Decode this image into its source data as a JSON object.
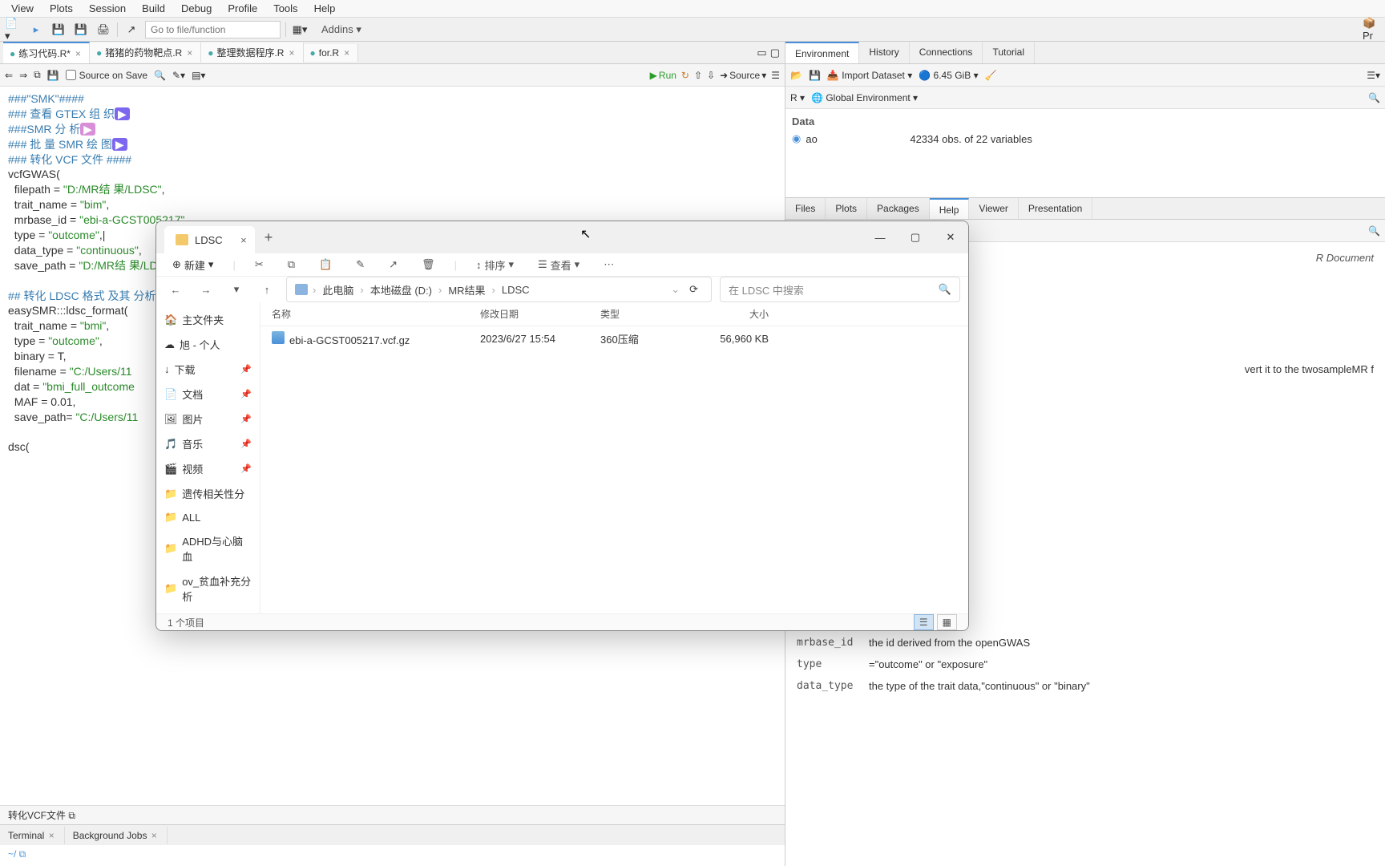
{
  "rstudio": {
    "menu": [
      "View",
      "Plots",
      "Session",
      "Build",
      "Debug",
      "Profile",
      "Tools",
      "Help"
    ],
    "goto_placeholder": "Go to file/function",
    "addins": "Addins",
    "source_tabs": [
      {
        "label": "练习代码.R*",
        "active": true
      },
      {
        "label": "猪猪的药物靶点.R"
      },
      {
        "label": "整理数据程序.R"
      },
      {
        "label": "for.R"
      }
    ],
    "source_on_save": "Source on Save",
    "run": "Run",
    "source_btn": "Source",
    "code_lines": [
      {
        "t": "comment",
        "v": "###\"SMK\"####"
      },
      {
        "t": "comment_btn",
        "v": "### 查看 GTEX 组 织",
        "btn": "▶"
      },
      {
        "t": "comment_btn2",
        "v": "###SMR 分 析",
        "btn": "▶"
      },
      {
        "t": "comment_btn",
        "v": "### 批 量 SMR 绘 图",
        "btn": "▶"
      },
      {
        "t": "comment",
        "v": "### 转化 VCF 文件 ####"
      },
      {
        "t": "plain",
        "v": "vcfGWAS("
      },
      {
        "t": "arg",
        "k": "  filepath = ",
        "s": "\"D:/MR结 果/LDSC\"",
        "e": ","
      },
      {
        "t": "arg",
        "k": "  trait_name = ",
        "s": "\"bim\"",
        "e": ","
      },
      {
        "t": "arg",
        "k": "  mrbase_id = ",
        "s": "\"ebi-a-GCST005217\"",
        "e": ","
      },
      {
        "t": "arg",
        "k": "  type = ",
        "s": "\"outcome\"",
        "e": ",|"
      },
      {
        "t": "arg",
        "k": "  data_type = ",
        "s": "\"continuous\"",
        "e": ","
      },
      {
        "t": "arg",
        "k": "  save_path = ",
        "s": "\"D:/MR结 果/LDSC\"",
        "e": ""
      },
      {
        "t": "blank",
        "v": ""
      },
      {
        "t": "comment",
        "v": "## 转化 LDSC 格式 及其 分析 ##"
      },
      {
        "t": "plain",
        "v": "easySMR:::ldsc_format("
      },
      {
        "t": "arg",
        "k": "  trait_name = ",
        "s": "\"bmi\"",
        "e": ","
      },
      {
        "t": "arg",
        "k": "  type = ",
        "s": "\"outcome\"",
        "e": ","
      },
      {
        "t": "plain",
        "v": "  binary = T,"
      },
      {
        "t": "arg",
        "k": "  filename = ",
        "s": "\"C:/Users/11",
        "e": ""
      },
      {
        "t": "arg",
        "k": "  dat = ",
        "s": "\"bmi_full_outcome",
        "e": ""
      },
      {
        "t": "plain",
        "v": "  MAF = 0.01,"
      },
      {
        "t": "arg",
        "k": "  save_path= ",
        "s": "\"C:/Users/11",
        "e": ""
      },
      {
        "t": "blank",
        "v": ""
      },
      {
        "t": "plain",
        "v": "dsc("
      }
    ],
    "code_status": "转化VCF文件  ⧉",
    "console_tabs": [
      "Terminal",
      "Background Jobs"
    ],
    "console_prompt": "~/ ⧉"
  },
  "env": {
    "tabs": [
      "Environment",
      "History",
      "Connections",
      "Tutorial"
    ],
    "import": "Import Dataset",
    "mem": "6.45 GiB",
    "scope_r": "R",
    "scope_global": "Global Environment",
    "heading": "Data",
    "rows": [
      {
        "name": "ao",
        "val": "42334 obs. of 22 variables"
      }
    ]
  },
  "help": {
    "tabs": [
      "Files",
      "Plots",
      "Packages",
      "Help",
      "Viewer",
      "Presentation"
    ],
    "doc_label": "R Document",
    "snippet": "vert it to the twosampleMR f",
    "args": [
      {
        "n": "mrbase_id",
        "d": "the id derived from the openGWAS"
      },
      {
        "n": "type",
        "d": "=\"outcome\" or \"exposure\""
      },
      {
        "n": "data_type",
        "d": "the type of the trait data,\"continuous\" or \"binary\""
      }
    ]
  },
  "explorer": {
    "tab_title": "LDSC",
    "toolbar": {
      "new": "新建",
      "sort": "排序",
      "view": "查看"
    },
    "breadcrumb": [
      "此电脑",
      "本地磁盘 (D:)",
      "MR结果",
      "LDSC"
    ],
    "search_placeholder": "在 LDSC 中搜索",
    "side": [
      {
        "kind": "home",
        "label": "主文件夹"
      },
      {
        "kind": "cloud",
        "label": "旭 - 个人"
      },
      {
        "kind": "dl",
        "label": "下载",
        "pin": true
      },
      {
        "kind": "doc",
        "label": "文档",
        "pin": true
      },
      {
        "kind": "pic",
        "label": "图片",
        "pin": true
      },
      {
        "kind": "music",
        "label": "音乐",
        "pin": true
      },
      {
        "kind": "video",
        "label": "视频",
        "pin": true
      },
      {
        "kind": "folder",
        "label": "遗传相关性分"
      },
      {
        "kind": "folder",
        "label": "ALL"
      },
      {
        "kind": "folder",
        "label": "ADHD与心脑血"
      },
      {
        "kind": "folder",
        "label": "ov_贫血补充分析"
      }
    ],
    "cols": {
      "name": "名称",
      "date": "修改日期",
      "type": "类型",
      "size": "大小"
    },
    "rows": [
      {
        "name": "ebi-a-GCST005217.vcf.gz",
        "date": "2023/6/27 15:54",
        "type": "360压缩",
        "size": "56,960 KB"
      }
    ],
    "status": "1 个项目"
  }
}
